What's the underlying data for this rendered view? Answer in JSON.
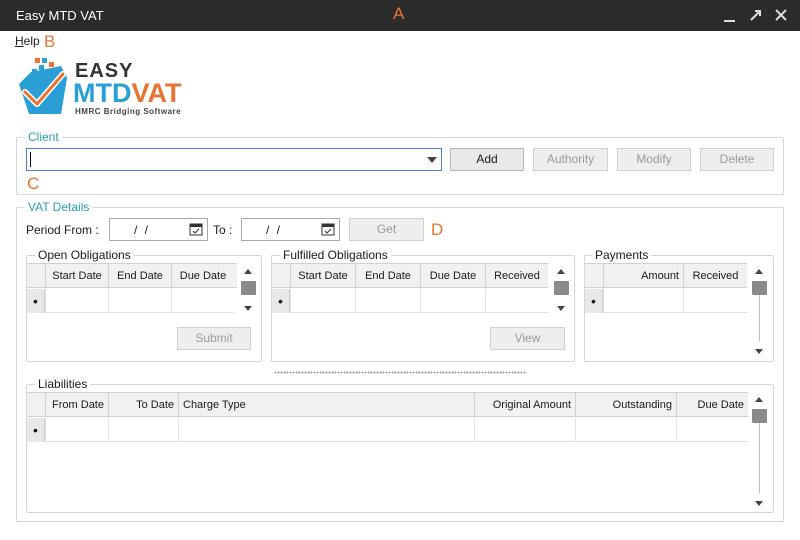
{
  "window": {
    "title": "Easy MTD VAT"
  },
  "annotations": {
    "a": "A",
    "b": "B",
    "c": "C",
    "d": "D"
  },
  "menu": {
    "help_first": "H",
    "help_rest": "elp"
  },
  "logo": {
    "easy": "EASY",
    "mtd": "MTD",
    "vat": "VAT",
    "subtitle": "HMRC Bridging Software"
  },
  "client": {
    "label": "Client",
    "value": "",
    "add_label": "Add",
    "authority_label": "Authority",
    "modify_label": "Modify",
    "delete_label": "Delete"
  },
  "vat": {
    "label": "VAT Details",
    "period_from_label": "Period From :",
    "to_label": "To :",
    "from_value": "/ /",
    "to_value": "/ /",
    "get_label": "Get"
  },
  "open_obligations": {
    "label": "Open Obligations",
    "columns": [
      "Start Date",
      "End Date",
      "Due Date"
    ],
    "submit_label": "Submit"
  },
  "fulfilled_obligations": {
    "label": "Fulfilled Obligations",
    "columns": [
      "Start Date",
      "End Date",
      "Due Date",
      "Received"
    ],
    "view_label": "View"
  },
  "payments": {
    "label": "Payments",
    "columns": [
      "Amount",
      "Received"
    ]
  },
  "liabilities": {
    "label": "Liabilities",
    "columns": [
      "From Date",
      "To Date",
      "Charge Type",
      "Original Amount",
      "Outstanding",
      "Due Date"
    ]
  },
  "row_indicator": "•",
  "colors": {
    "titlebar": "#2b2b2b",
    "accent": "#e8732f",
    "group_label": "#2a9fb0",
    "brand_blue": "#2a9fd6"
  }
}
